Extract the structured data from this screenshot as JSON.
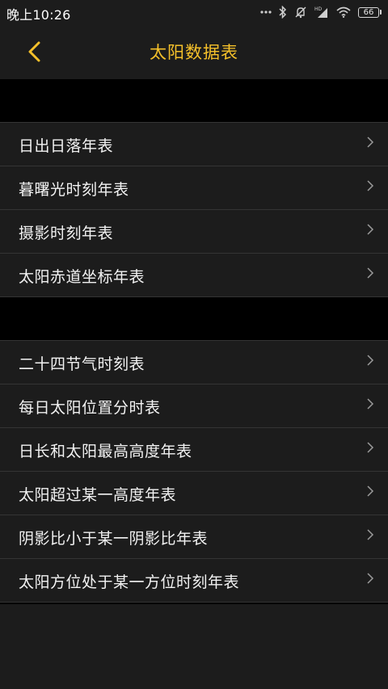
{
  "status_bar": {
    "time": "晚上10:26",
    "battery": "66",
    "icons": [
      "dots-icon",
      "bluetooth-icon",
      "mute-icon",
      "hd-signal-icon",
      "wifi-icon",
      "battery-icon"
    ]
  },
  "header": {
    "title": "太阳数据表",
    "back_icon": "chevron-left-icon",
    "accent_color": "#f5c02a"
  },
  "groups": [
    {
      "items": [
        {
          "label": "日出日落年表"
        },
        {
          "label": "暮曙光时刻年表"
        },
        {
          "label": "摄影时刻年表"
        },
        {
          "label": "太阳赤道坐标年表"
        }
      ]
    },
    {
      "items": [
        {
          "label": "二十四节气时刻表"
        },
        {
          "label": "每日太阳位置分时表"
        },
        {
          "label": "日长和太阳最高高度年表"
        },
        {
          "label": "太阳超过某一高度年表"
        },
        {
          "label": "阴影比小于某一阴影比年表"
        },
        {
          "label": "太阳方位处于某一方位时刻年表"
        }
      ]
    }
  ]
}
